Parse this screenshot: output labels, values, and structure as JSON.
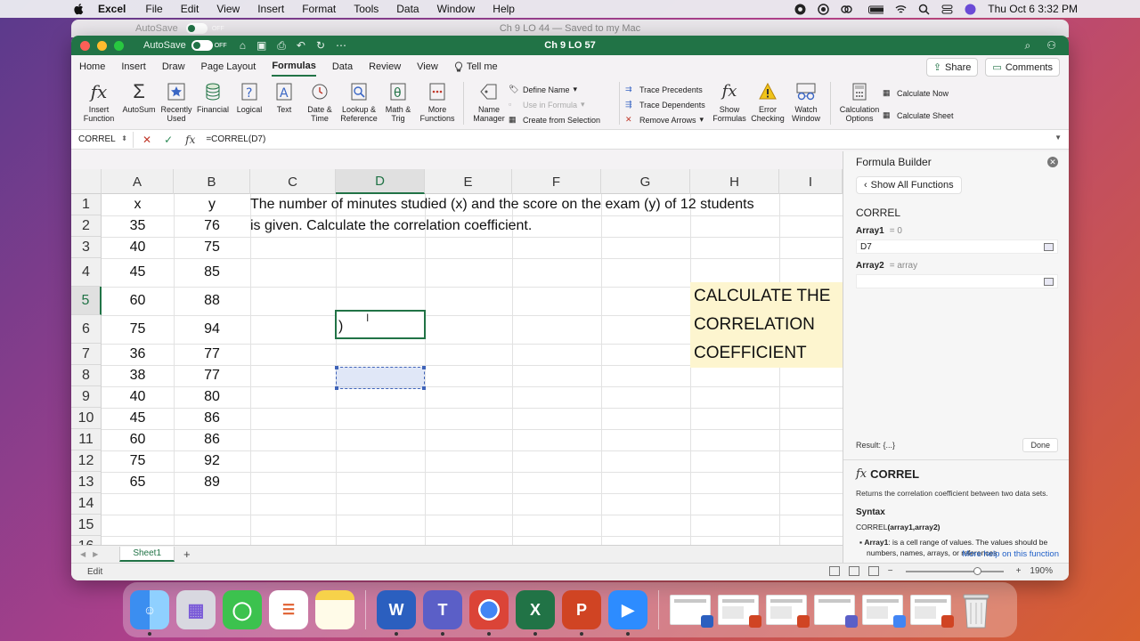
{
  "menubar": {
    "app": "Excel",
    "items": [
      "File",
      "Edit",
      "View",
      "Insert",
      "Format",
      "Tools",
      "Data",
      "Window",
      "Help"
    ],
    "clock": "Thu Oct 6  3:32 PM"
  },
  "bg_window": {
    "title": "Ch 9 LO 44 — Saved to my Mac",
    "autosave": "AutoSave",
    "toggle": "OFF"
  },
  "window": {
    "title": "Ch 9 LO 57",
    "autosave": "AutoSave",
    "toggle": "OFF"
  },
  "ribbon_tabs": [
    "Home",
    "Insert",
    "Draw",
    "Page Layout",
    "Formulas",
    "Data",
    "Review",
    "View"
  ],
  "active_tab": "Formulas",
  "tell_me": "Tell me",
  "share_label": "Share",
  "comments_label": "Comments",
  "ribbon": {
    "insert_function": "Insert Function",
    "autosum": "AutoSum",
    "recently_used": "Recently Used",
    "financial": "Financial",
    "logical": "Logical",
    "text": "Text",
    "date_time": "Date & Time",
    "lookup_reference": "Lookup & Reference",
    "math_trig": "Math & Trig",
    "more_functions": "More Functions",
    "name_manager": "Name Manager",
    "define_name": "Define Name",
    "use_in_formula": "Use in Formula",
    "create_from_selection": "Create from Selection",
    "trace_precedents": "Trace Precedents",
    "trace_dependents": "Trace Dependents",
    "remove_arrows": "Remove Arrows",
    "show_formulas": "Show Formulas",
    "error_checking": "Error Checking",
    "watch_window": "Watch Window",
    "calculation_options": "Calculation Options",
    "calculate_now": "Calculate Now",
    "calculate_sheet": "Calculate Sheet"
  },
  "formula_bar": {
    "namebox": "CORREL",
    "formula": "=CORREL(D7)"
  },
  "columns": [
    "A",
    "B",
    "C",
    "D",
    "E",
    "F",
    "G",
    "H",
    "I"
  ],
  "active_column": "D",
  "rows": [
    "1",
    "2",
    "3",
    "4",
    "5",
    "6",
    "7",
    "8",
    "9",
    "10",
    "11",
    "12",
    "13",
    "14",
    "15",
    "16"
  ],
  "active_row": "5",
  "data_table": {
    "header": [
      "x",
      "y"
    ],
    "rows": [
      [
        "35",
        "76"
      ],
      [
        "40",
        "75"
      ],
      [
        "45",
        "85"
      ],
      [
        "60",
        "88"
      ],
      [
        "75",
        "94"
      ],
      [
        "36",
        "77"
      ],
      [
        "38",
        "77"
      ],
      [
        "40",
        "80"
      ],
      [
        "45",
        "86"
      ],
      [
        "60",
        "86"
      ],
      [
        "75",
        "92"
      ],
      [
        "65",
        "89"
      ]
    ]
  },
  "problem_text": [
    "The number of minutes studied (x) and the score on the exam (y) of 12 students",
    "is given. Calculate the correlation coefficient."
  ],
  "active_cell_text": ")",
  "callout": [
    "CALCULATE THE",
    "CORRELATION",
    "COEFFICIENT"
  ],
  "builder": {
    "title": "Formula Builder",
    "show_all": "Show All Functions",
    "function": "CORREL",
    "array1_label": "Array1",
    "array1_eq": "= 0",
    "array1_value": "D7",
    "array2_label": "Array2",
    "array2_eq": "= array",
    "array2_value": "",
    "result": "Result: {...}",
    "done": "Done",
    "help_title": "CORREL",
    "help_desc": "Returns the correlation coefficient between two data sets.",
    "syntax_label": "Syntax",
    "syntax_fn": "CORREL",
    "syntax_args": "(array1,array2)",
    "arg_name": "Array1",
    "arg_desc": ": is a cell range of values. The values should be numbers, names, arrays, or references",
    "more_help": "More help on this function"
  },
  "sheet_tab": "Sheet1",
  "status": {
    "mode": "Edit",
    "zoom": "190%"
  },
  "colors": {
    "excel_green": "#217346",
    "callout_bg": "#fdf5cf",
    "ref_blue": "#3f63b8"
  }
}
